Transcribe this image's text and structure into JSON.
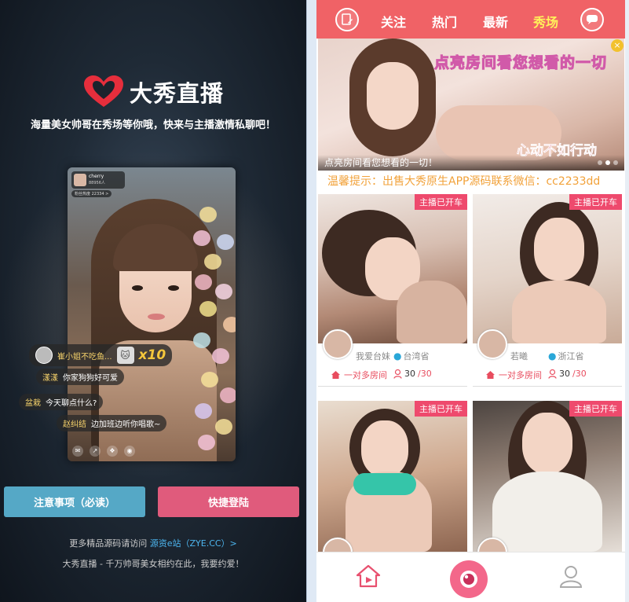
{
  "left": {
    "brand": "大秀直播",
    "slogan": "海量美女帅哥在秀场等你哦，快来与主播激情私聊吧！",
    "anchor_card": {
      "name": "cherry",
      "count": "88956人"
    },
    "fans_badge": "粉丝热度 22334 >",
    "chat": [
      {
        "name": "崔小姐不吃鱼...",
        "msg": ""
      },
      {
        "name": "漾漾",
        "msg": "你家狗狗好可爱"
      },
      {
        "name": "盆栽",
        "msg": "今天聊点什么?"
      },
      {
        "name": "赵纠结",
        "msg": "边加班边听你唱歌~"
      }
    ],
    "gift_multiplier": "x10",
    "btn_notes": "注意事项（必读）",
    "btn_login": "快捷登陆",
    "more_prefix": "更多精品源码请访问 ",
    "more_link": "源资e站（ZYE.CC）>",
    "footer": "大秀直播 - 千万帅哥美女相约在此，我要约爱！"
  },
  "right": {
    "tabs": [
      "关注",
      "热门",
      "最新",
      "秀场"
    ],
    "active_tab": "秀场",
    "banner": {
      "headline": "点亮房间看您想看的一切",
      "slogan": "心动不如行动",
      "caption": "点亮房间看您想看的一切！"
    },
    "notice": "温馨提示：出售大秀原生APP源码联系微信：cc2233dd",
    "cards": [
      {
        "tag": "主播已开车",
        "nick": "我爱台妹",
        "location": "台湾省",
        "room": "一对多房间",
        "current": "30",
        "max": "/30"
      },
      {
        "tag": "主播已开车",
        "nick": "若曦",
        "location": "浙江省",
        "room": "一对多房间",
        "current": "30",
        "max": "/30"
      },
      {
        "tag": "主播已开车"
      },
      {
        "tag": "主播已开车"
      }
    ]
  },
  "colors": {
    "topbar": "#f06266",
    "active_tab": "#fff15a",
    "notes_button": "#55a8c6",
    "login_button": "#e05b7c",
    "tag": "#ee4a6d",
    "notice": "#f2a23a"
  },
  "icons": {
    "topbar_left": "edit-icon",
    "topbar_right": "chat-icon",
    "nav_home": "home-icon",
    "nav_live": "camera-icon",
    "nav_me": "user-icon"
  }
}
